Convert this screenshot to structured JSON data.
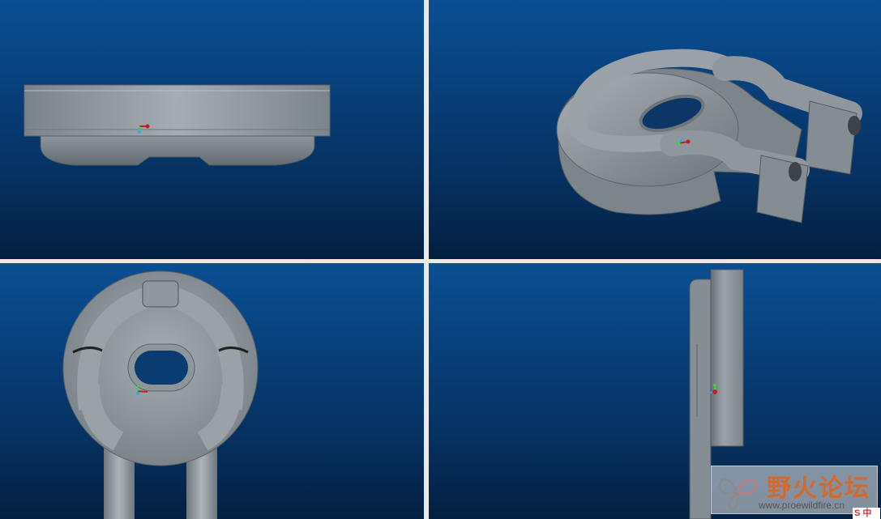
{
  "toolbar": {
    "buttons": [
      {
        "icon": "refit-icon",
        "active": false
      },
      {
        "icon": "zoom-in-icon",
        "active": false
      },
      {
        "icon": "zoom-out-icon",
        "active": false
      },
      {
        "icon": "repaint-icon",
        "active": false
      },
      {
        "icon": "shading-icon",
        "active": false
      },
      {
        "icon": "saved-views-icon",
        "active": false
      },
      {
        "icon": "view-manager-icon",
        "active": false
      },
      {
        "icon": "orient-icon",
        "active": false
      },
      {
        "icon": "datum-planes-icon",
        "active": true
      },
      {
        "icon": "datum-axes-icon",
        "active": true
      },
      {
        "icon": "datum-points-icon",
        "active": false
      },
      {
        "icon": "coordinate-systems-icon",
        "active": true
      },
      {
        "icon": "spin-center-icon",
        "active": false
      },
      {
        "icon": "annotations-icon",
        "active": false
      },
      {
        "icon": "display-style-icon",
        "active": false
      }
    ]
  },
  "viewports": {
    "front": "front-view",
    "isometric": "isometric-view",
    "top": "top-view",
    "side": "side-view"
  },
  "watermark": {
    "title": "野火论坛",
    "url": "www.proewildfire.cn"
  },
  "ime": {
    "label": "S 中"
  },
  "colors": {
    "viewport_top": "#0a4f93",
    "viewport_bottom": "#041f40",
    "part_gray": "#8d959c",
    "divider": "#e9e9e9"
  }
}
